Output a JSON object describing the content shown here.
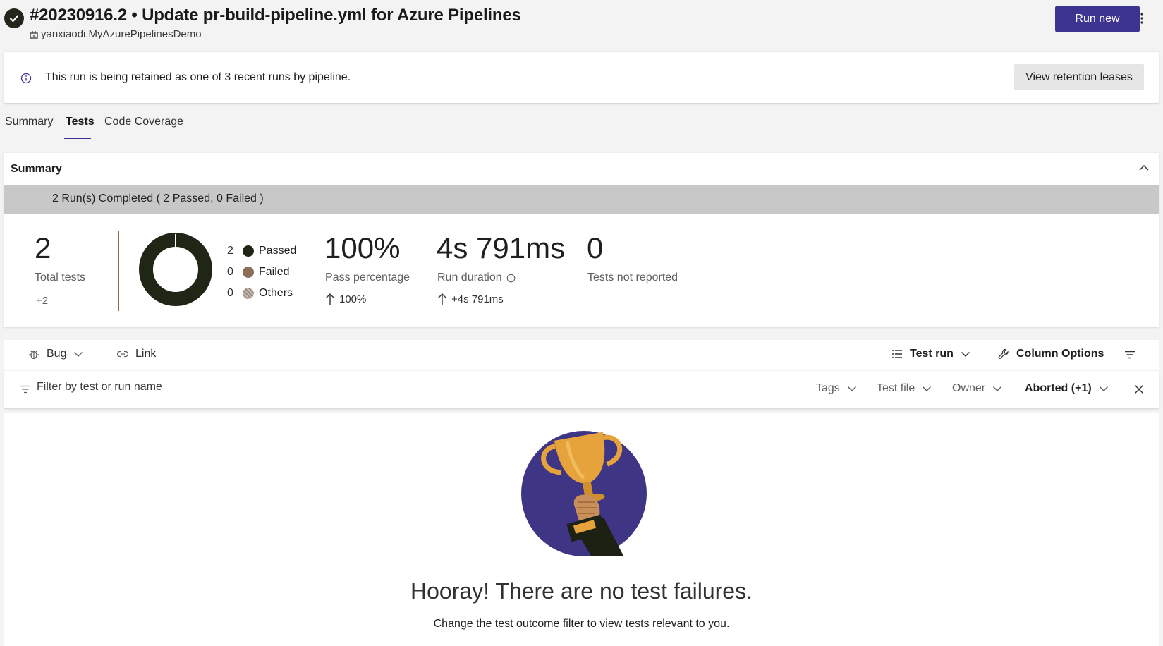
{
  "header": {
    "title": "#20230916.2 • Update pr-build-pipeline.yml for Azure Pipelines",
    "repo": "yanxiaodi.MyAzurePipelinesDemo",
    "run_new_label": "Run new",
    "status_icon": "check-circle-icon",
    "accent_color": "#3d3390"
  },
  "banner": {
    "message": "This run is being retained as one of 3 recent runs by pipeline.",
    "button_label": "View retention leases"
  },
  "tabs": [
    {
      "label": "Summary",
      "active": false
    },
    {
      "label": "Tests",
      "active": true
    },
    {
      "label": "Code Coverage",
      "active": false
    }
  ],
  "summary": {
    "title": "Summary",
    "runs_status": "2 Run(s) Completed ( 2 Passed, 0 Failed )",
    "total_tests": "2",
    "total_label": "Total tests",
    "total_delta": "+2",
    "legend": [
      {
        "count": "2",
        "label": "Passed",
        "color": "#1f2616"
      },
      {
        "count": "0",
        "label": "Failed",
        "color": "#8d6e58"
      },
      {
        "count": "0",
        "label": "Others",
        "color": "#9a8a80"
      }
    ],
    "pass_percentage": "100%",
    "pass_label": "Pass percentage",
    "pass_delta": "100%",
    "run_duration": "4s 791ms",
    "duration_label": "Run duration",
    "duration_delta": "+4s 791ms",
    "not_reported": "0",
    "not_reported_label": "Tests not reported"
  },
  "toolbar": {
    "bug_label": "Bug",
    "link_label": "Link",
    "group_label": "Test run",
    "column_options_label": "Column Options"
  },
  "filter": {
    "placeholder": "Filter by test or run name",
    "tags_label": "Tags",
    "test_file_label": "Test file",
    "owner_label": "Owner",
    "outcome_label": "Aborted (+1)"
  },
  "results": {
    "heading": "Hooray! There are no test failures.",
    "hint": "Change the test outcome filter to view tests relevant to you."
  }
}
